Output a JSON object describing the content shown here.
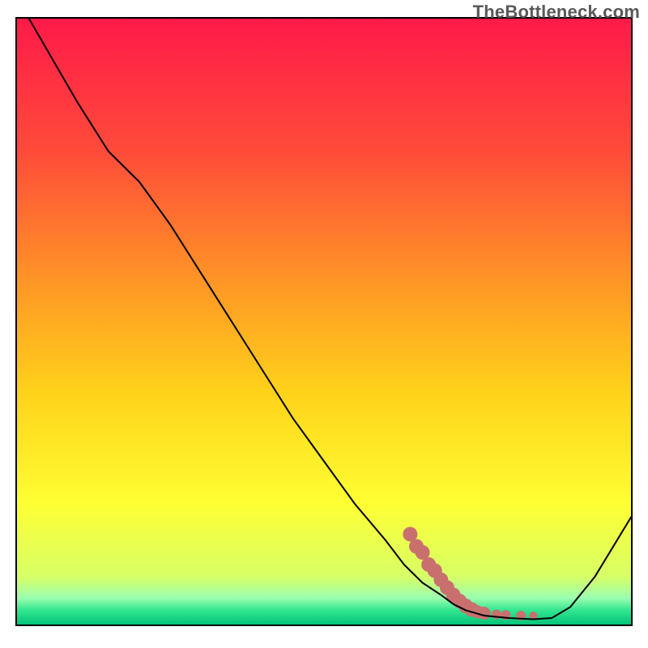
{
  "watermark": "TheBottleneck.com",
  "chart_data": {
    "type": "line",
    "title": "",
    "xlabel": "",
    "ylabel": "",
    "xlim": [
      0,
      100
    ],
    "ylim": [
      0,
      100
    ],
    "grid": false,
    "background_gradient": {
      "stops": [
        {
          "offset": 0.0,
          "color": "#ff1a49"
        },
        {
          "offset": 0.22,
          "color": "#ff4b3a"
        },
        {
          "offset": 0.45,
          "color": "#ff9b24"
        },
        {
          "offset": 0.62,
          "color": "#ffd31a"
        },
        {
          "offset": 0.8,
          "color": "#ffff33"
        },
        {
          "offset": 0.92,
          "color": "#d7ff66"
        },
        {
          "offset": 0.955,
          "color": "#9bffb0"
        },
        {
          "offset": 0.975,
          "color": "#33e690"
        },
        {
          "offset": 1.0,
          "color": "#00c27a"
        }
      ]
    },
    "series": [
      {
        "name": "bottleneck-curve",
        "color": "#000000",
        "x": [
          2,
          6,
          10,
          15,
          20,
          25,
          30,
          35,
          40,
          45,
          50,
          55,
          60,
          63,
          66,
          69,
          71,
          73,
          76,
          80,
          84,
          87,
          90,
          94,
          100
        ],
        "y": [
          100,
          93,
          86,
          78,
          73,
          66,
          58,
          50,
          42,
          34,
          27,
          20,
          14,
          10,
          7,
          5,
          3.5,
          2.5,
          1.6,
          1.2,
          1.0,
          1.2,
          3,
          8,
          18
        ]
      }
    ],
    "markers": {
      "name": "highlight-points",
      "color": "#c9706f",
      "items": [
        {
          "x": 64,
          "y": 15,
          "r": 9
        },
        {
          "x": 65,
          "y": 13,
          "r": 9
        },
        {
          "x": 66,
          "y": 12,
          "r": 9
        },
        {
          "x": 67,
          "y": 10,
          "r": 9
        },
        {
          "x": 68,
          "y": 9,
          "r": 9
        },
        {
          "x": 69,
          "y": 7.5,
          "r": 9
        },
        {
          "x": 70,
          "y": 6.2,
          "r": 9
        },
        {
          "x": 71,
          "y": 5.0,
          "r": 9
        },
        {
          "x": 72,
          "y": 4.0,
          "r": 9
        },
        {
          "x": 73,
          "y": 3.2,
          "r": 9
        },
        {
          "x": 74,
          "y": 2.6,
          "r": 9
        },
        {
          "x": 75,
          "y": 2.2,
          "r": 8
        },
        {
          "x": 76,
          "y": 2.0,
          "r": 8
        },
        {
          "x": 78,
          "y": 1.8,
          "r": 6
        },
        {
          "x": 79.5,
          "y": 1.7,
          "r": 6
        },
        {
          "x": 82,
          "y": 1.6,
          "r": 6
        },
        {
          "x": 84,
          "y": 1.6,
          "r": 5
        }
      ]
    }
  }
}
